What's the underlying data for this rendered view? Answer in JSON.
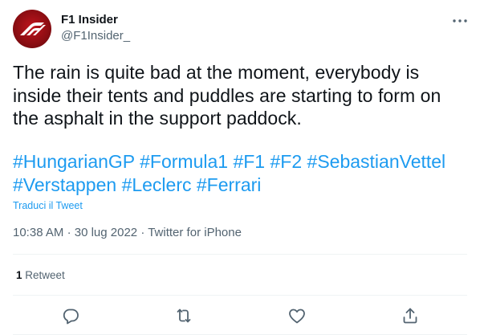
{
  "author": {
    "name": "F1 Insider",
    "handle": "@F1Insider_"
  },
  "tweet": {
    "text": "The rain is quite bad at the moment, everybody is inside their tents and puddles are starting to form on the asphalt in the support paddock.",
    "hashtags": [
      "#HungarianGP",
      "#Formula1",
      "#F1",
      "#F2",
      "#SebastianVettel",
      "#Verstappen",
      "#Leclerc",
      "#Ferrari"
    ],
    "translate_label": "Traduci il Tweet",
    "time": "10:38 AM",
    "date": "30 lug 2022",
    "source": "Twitter for iPhone",
    "separator": "·"
  },
  "stats": {
    "retweet_count": "1",
    "retweet_label": "Retweet"
  },
  "icons": {
    "more": "more-icon",
    "reply": "reply-icon",
    "retweet": "retweet-icon",
    "like": "like-icon",
    "share": "share-icon"
  },
  "colors": {
    "accent": "#1d9bf0",
    "secondary_text": "#536471",
    "avatar_red": "#b0121a"
  }
}
